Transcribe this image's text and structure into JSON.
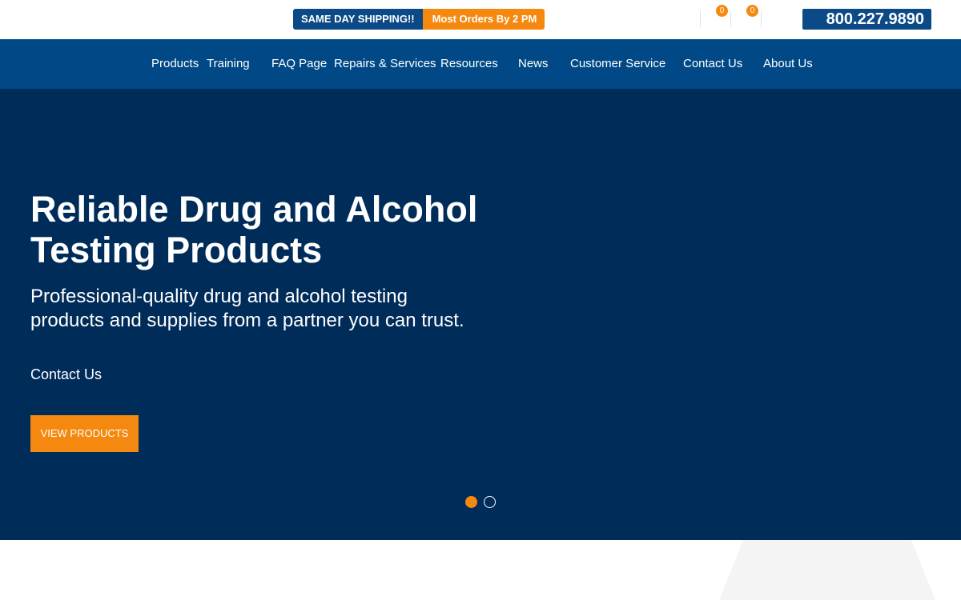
{
  "topbar": {
    "shipping_label": "SAME DAY SHIPPING!!",
    "shipping_detail": "Most Orders By 2 PM",
    "wishlist_count": "0",
    "cart_count": "0",
    "phone": "800.227.9890"
  },
  "nav": {
    "items": [
      {
        "label": "Products"
      },
      {
        "label": "Training"
      },
      {
        "label": "FAQ Page"
      },
      {
        "label": "Repairs & Services"
      },
      {
        "label": "Resources"
      },
      {
        "label": "News"
      },
      {
        "label": "Customer Service"
      },
      {
        "label": "Contact Us"
      },
      {
        "label": "About Us"
      }
    ]
  },
  "hero": {
    "title": "Reliable Drug and Alcohol Testing Products",
    "subtitle": "Professional-quality drug and alcohol testing products and supplies from a partner you can trust.",
    "contact_link": "Contact Us",
    "cta_label": "VIEW PRODUCTS",
    "slide_count": 2,
    "active_slide": 1
  },
  "colors": {
    "brand_blue": "#004986",
    "hero_navy": "#002c5a",
    "accent_orange": "#f5890f"
  }
}
